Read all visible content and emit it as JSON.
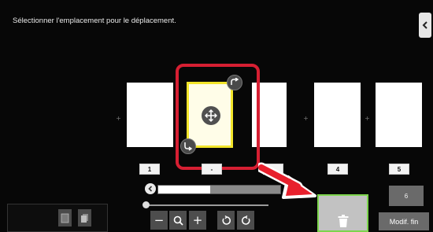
{
  "instruction": "Sélectionner l'emplacement pour le déplacement.",
  "pages": [
    {
      "number": "1"
    },
    {
      "number": "-"
    },
    {
      "number": ""
    },
    {
      "number": "4"
    },
    {
      "number": "5"
    }
  ],
  "page_count": "6",
  "finish_label": "Modif. fin",
  "icons": {
    "collapse": "chevron-left-icon",
    "move": "move-arrows-icon",
    "rotate_right": "rotate-right-icon",
    "rotate_left": "rotate-left-icon",
    "trash": "trash-icon"
  },
  "colors": {
    "highlight": "#d61f32",
    "selection_border": "#f2e52a",
    "trash_border": "#7cd44c",
    "arrow": "#e8202d"
  }
}
